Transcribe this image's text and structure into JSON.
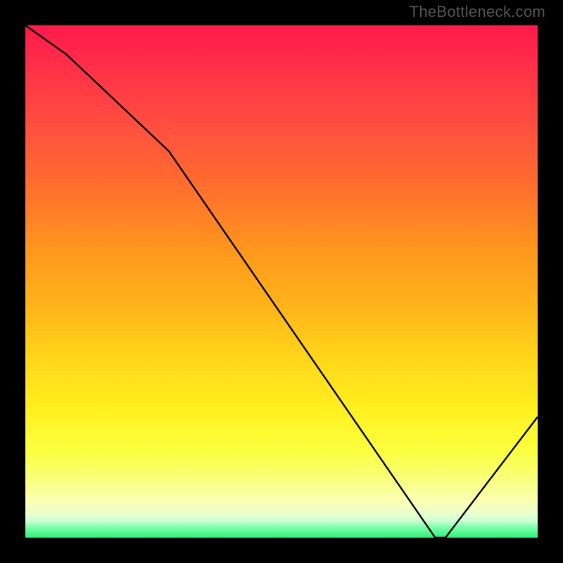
{
  "watermark": "TheBottleneck.com",
  "plot": {
    "widthPx": 728,
    "heightPx": 728,
    "bottomLabel": {
      "text": "",
      "xPercent": 78
    }
  },
  "chart_data": {
    "type": "line",
    "x": [
      0,
      8,
      28,
      80,
      82,
      100
    ],
    "y": [
      106,
      100,
      80,
      0,
      0,
      25
    ],
    "xlabel": "",
    "ylabel": "",
    "title": "",
    "xlim": [
      0,
      100
    ],
    "ylim": [
      0,
      106
    ],
    "notes": "Large rainbow heatmap-style vertical gradient background from red (top) to green (bottom). Single black line descends from top-left, kinks near x≈28, continues linearly to near-zero at x≈80, flat along baseline, then rises to y≈25 at x=100."
  }
}
